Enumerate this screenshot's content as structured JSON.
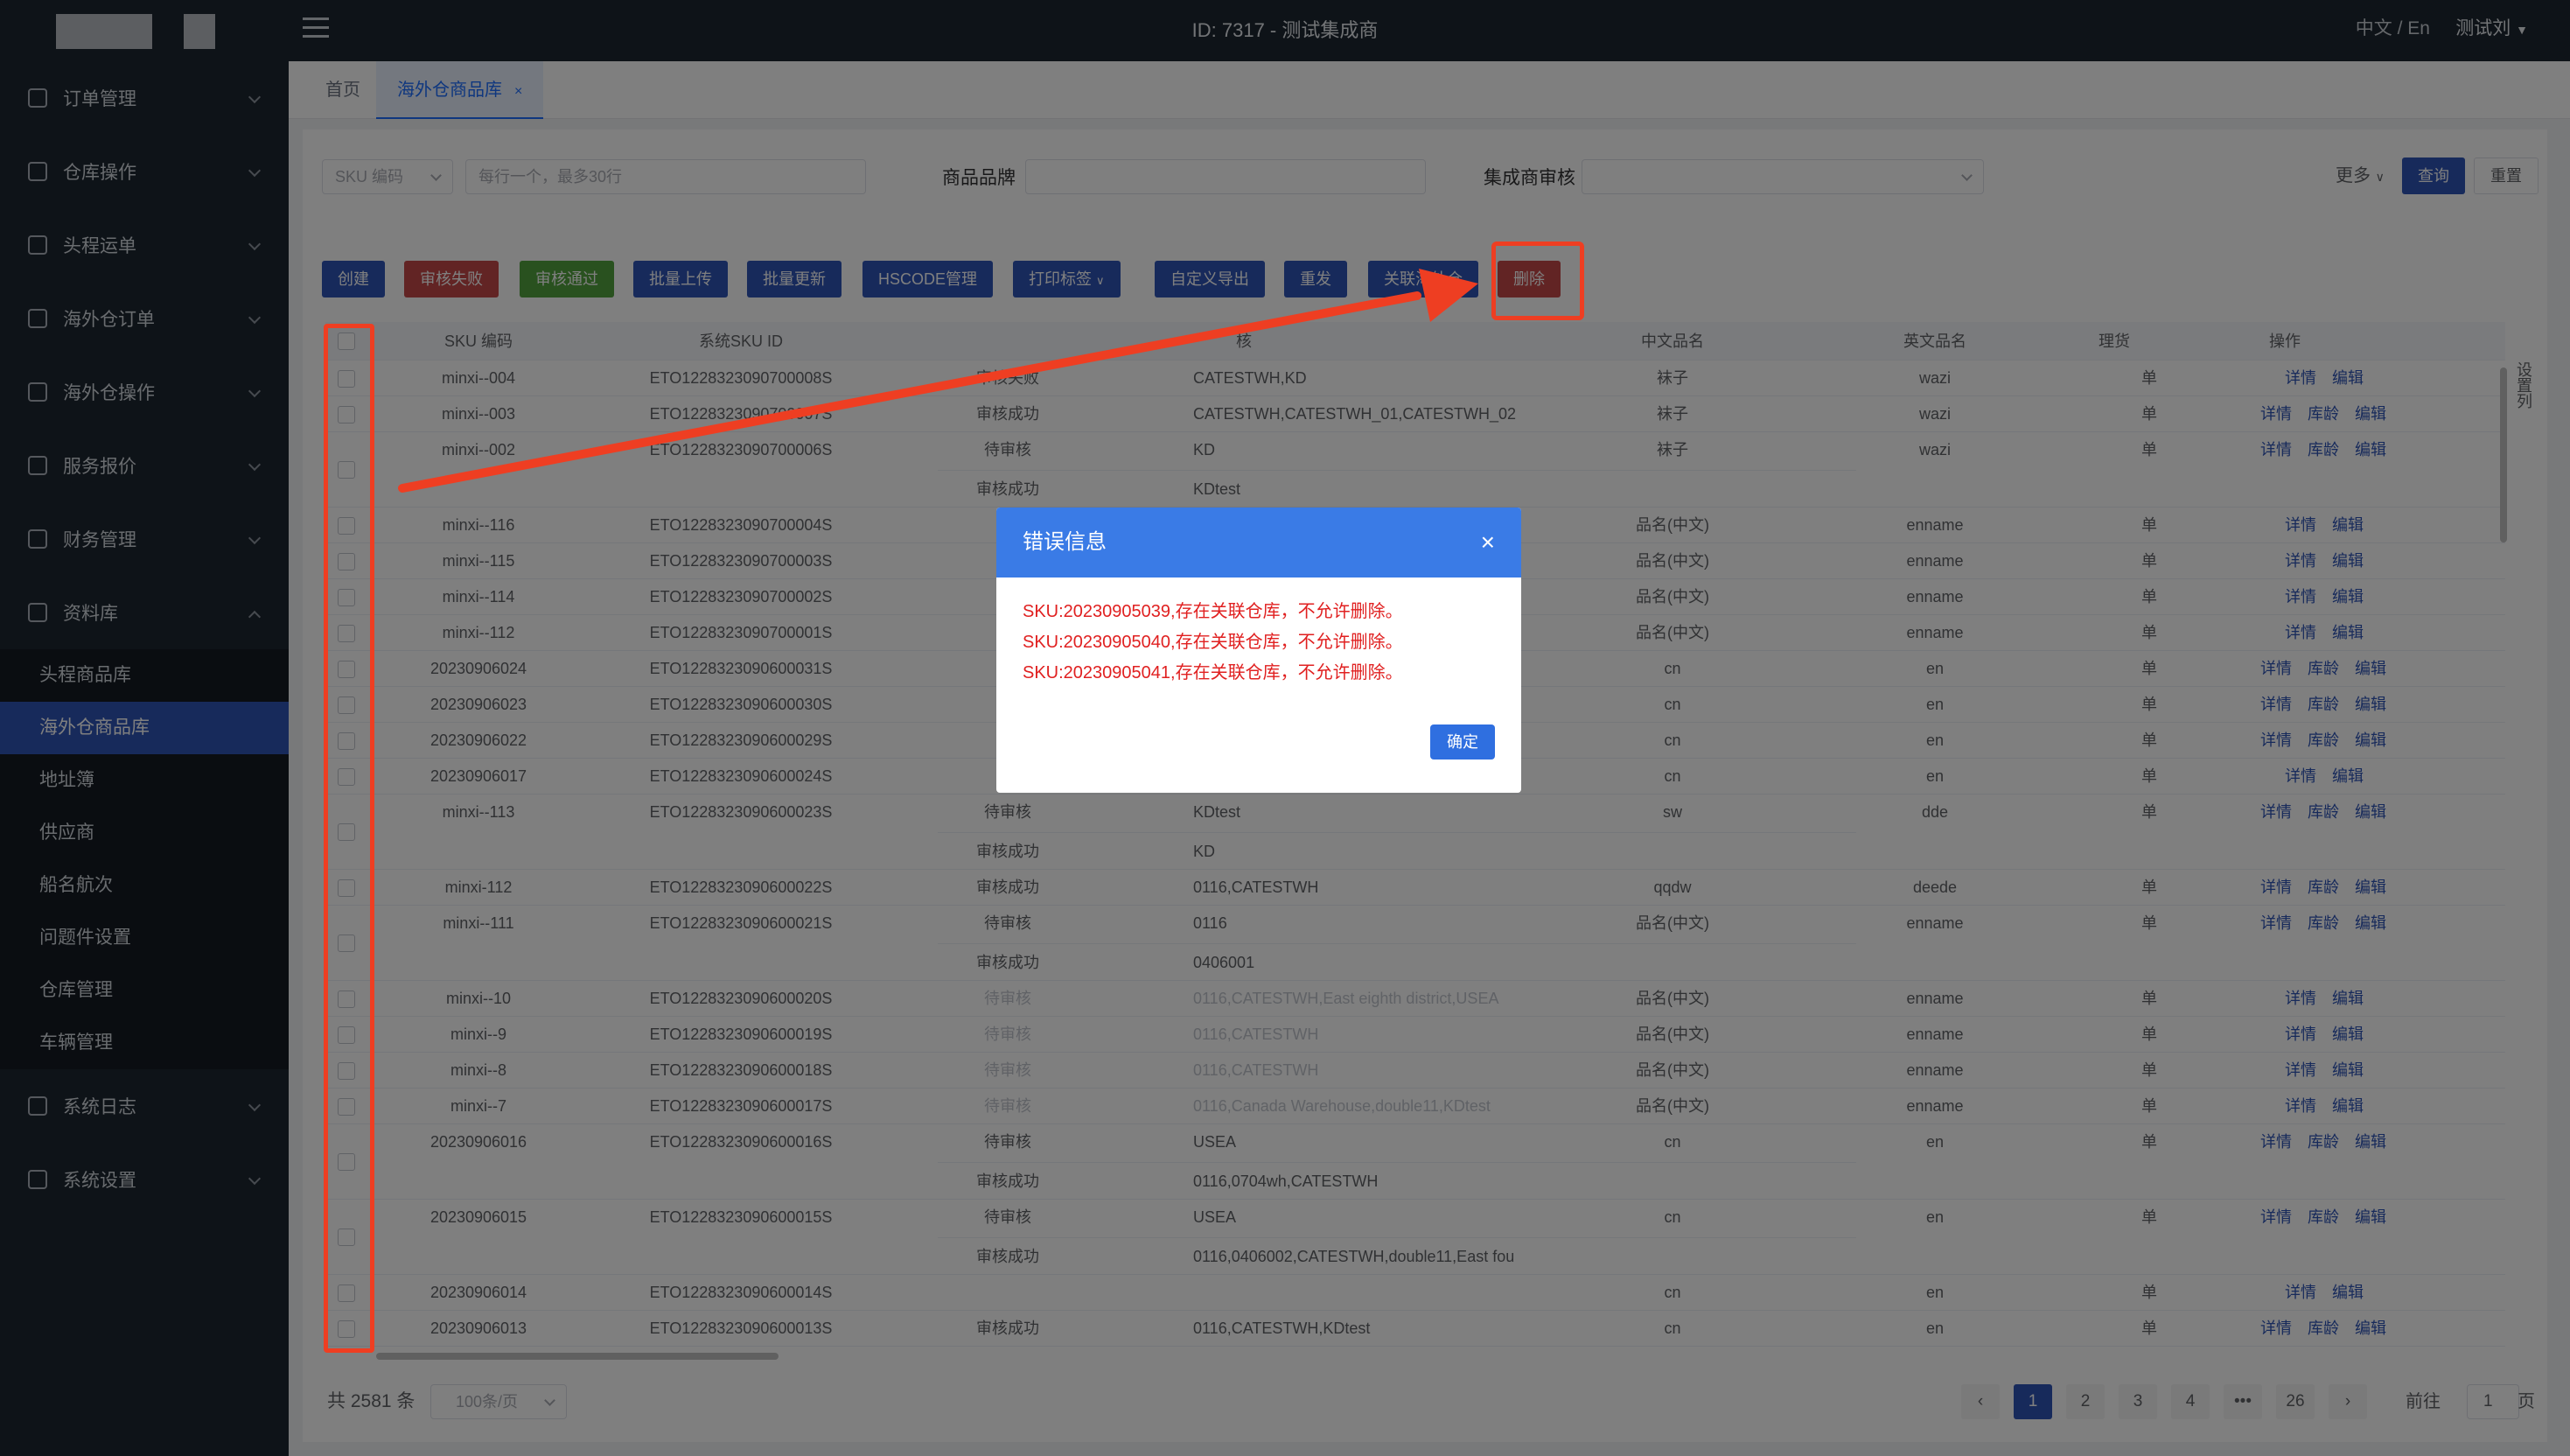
{
  "header": {
    "center_title": "ID: 7317 - 测试集成商",
    "lang": "中文 / En",
    "user": "测试刘"
  },
  "sidebar": {
    "items": [
      {
        "label": "订单管理",
        "icon": "order-icon"
      },
      {
        "label": "仓库操作",
        "icon": "warehouse-icon"
      },
      {
        "label": "头程运单",
        "icon": "waybill-icon"
      },
      {
        "label": "海外仓订单",
        "icon": "overseas-order-icon"
      },
      {
        "label": "海外仓操作",
        "icon": "overseas-ops-icon"
      },
      {
        "label": "服务报价",
        "icon": "quote-icon"
      },
      {
        "label": "财务管理",
        "icon": "finance-icon"
      },
      {
        "label": "资料库",
        "icon": "database-icon"
      },
      {
        "label": "系统日志",
        "icon": "log-icon"
      },
      {
        "label": "系统设置",
        "icon": "settings-icon"
      }
    ],
    "sub_items": [
      "头程商品库",
      "海外仓商品库",
      "地址簿",
      "供应商",
      "船名航次",
      "问题件设置",
      "仓库管理",
      "车辆管理"
    ]
  },
  "tabs": {
    "home": "首页",
    "current": "海外仓商品库",
    "close": "×"
  },
  "filters": {
    "sku_select": "SKU 编码",
    "sku_placeholder": "每行一个，最多30行",
    "brand_label": "商品品牌",
    "review_label": "集成商审核",
    "more": "更多",
    "query": "查询",
    "reset": "重置"
  },
  "toolbar": [
    "创建",
    "审核失败",
    "审核通过",
    "批量上传",
    "批量更新",
    "HSCODE管理",
    "打印标签",
    "自定义导出",
    "重发",
    "关联海外仓",
    "删除"
  ],
  "table": {
    "headers": [
      "SKU 编码",
      "系统SKU ID",
      "核",
      "中文品名",
      "英文品名",
      "理货",
      "操作"
    ],
    "rows": [
      {
        "sku": "minxi--004",
        "sys": "ETO1228323090700008S",
        "lines": [
          [
            "审核失败",
            "CATESTWH,KD"
          ]
        ],
        "cn": "袜子",
        "en": "wazi",
        "unit": "单",
        "ops": [
          "详情",
          "编辑"
        ]
      },
      {
        "sku": "minxi--003",
        "sys": "ETO1228323090700007S",
        "lines": [
          [
            "审核成功",
            "CATESTWH,CATESTWH_01,CATESTWH_02"
          ]
        ],
        "cn": "袜子",
        "en": "wazi",
        "unit": "单",
        "ops": [
          "详情",
          "库龄",
          "编辑"
        ]
      },
      {
        "sku": "minxi--002",
        "sys": "ETO1228323090700006S",
        "lines": [
          [
            "待审核",
            "KD"
          ],
          [
            "审核成功",
            "KDtest"
          ]
        ],
        "cn": "袜子",
        "en": "wazi",
        "unit": "单",
        "ops": [
          "详情",
          "库龄",
          "编辑"
        ]
      },
      {
        "sku": "minxi--116",
        "sys": "ETO1228323090700004S",
        "lines": [
          [
            "",
            ""
          ]
        ],
        "cn": "品名(中文)",
        "en": "enname",
        "unit": "单",
        "ops": [
          "详情",
          "编辑"
        ]
      },
      {
        "sku": "minxi--115",
        "sys": "ETO1228323090700003S",
        "lines": [
          [
            "",
            ""
          ]
        ],
        "cn": "品名(中文)",
        "en": "enname",
        "unit": "单",
        "ops": [
          "详情",
          "编辑"
        ]
      },
      {
        "sku": "minxi--114",
        "sys": "ETO1228323090700002S",
        "lines": [
          [
            "",
            ""
          ]
        ],
        "cn": "品名(中文)",
        "en": "enname",
        "unit": "单",
        "ops": [
          "详情",
          "编辑"
        ]
      },
      {
        "sku": "minxi--112",
        "sys": "ETO1228323090700001S",
        "lines": [
          [
            "",
            ""
          ]
        ],
        "cn": "品名(中文)",
        "en": "enname",
        "unit": "单",
        "ops": [
          "详情",
          "编辑"
        ]
      },
      {
        "sku": "20230906024",
        "sys": "ETO1228323090600031S",
        "lines": [
          [
            "",
            ""
          ]
        ],
        "cn": "cn",
        "en": "en",
        "unit": "单",
        "ops": [
          "详情",
          "库龄",
          "编辑"
        ]
      },
      {
        "sku": "20230906023",
        "sys": "ETO1228323090600030S",
        "lines": [
          [
            "",
            ""
          ]
        ],
        "cn": "cn",
        "en": "en",
        "unit": "单",
        "ops": [
          "详情",
          "库龄",
          "编辑"
        ]
      },
      {
        "sku": "20230906022",
        "sys": "ETO1228323090600029S",
        "lines": [
          [
            "",
            ""
          ]
        ],
        "cn": "cn",
        "en": "en",
        "unit": "单",
        "ops": [
          "详情",
          "库龄",
          "编辑"
        ]
      },
      {
        "sku": "20230906017",
        "sys": "ETO1228323090600024S",
        "lines": [
          [
            "",
            ""
          ]
        ],
        "cn": "cn",
        "en": "en",
        "unit": "单",
        "ops": [
          "详情",
          "编辑"
        ]
      },
      {
        "sku": "minxi--113",
        "sys": "ETO1228323090600023S",
        "lines": [
          [
            "待审核",
            "KDtest"
          ],
          [
            "审核成功",
            "KD"
          ]
        ],
        "cn": "sw",
        "en": "dde",
        "unit": "单",
        "ops": [
          "详情",
          "库龄",
          "编辑"
        ]
      },
      {
        "sku": "minxi-112",
        "sys": "ETO1228323090600022S",
        "lines": [
          [
            "审核成功",
            "0116,CATESTWH"
          ]
        ],
        "cn": "qqdw",
        "en": "deede",
        "unit": "单",
        "ops": [
          "详情",
          "库龄",
          "编辑"
        ]
      },
      {
        "sku": "minxi--111",
        "sys": "ETO1228323090600021S",
        "lines": [
          [
            "待审核",
            "0116"
          ],
          [
            "审核成功",
            "0406001"
          ]
        ],
        "cn": "品名(中文)",
        "en": "enname",
        "unit": "单",
        "ops": [
          "详情",
          "库龄",
          "编辑"
        ]
      },
      {
        "sku": "minxi--10",
        "sys": "ETO1228323090600020S",
        "lines": [
          [
            "待审核",
            "0116,CATESTWH,East eighth district,USEA"
          ]
        ],
        "faded": true,
        "cn": "品名(中文)",
        "en": "enname",
        "unit": "单",
        "ops": [
          "详情",
          "编辑"
        ]
      },
      {
        "sku": "minxi--9",
        "sys": "ETO1228323090600019S",
        "lines": [
          [
            "待审核",
            "0116,CATESTWH"
          ]
        ],
        "faded": true,
        "cn": "品名(中文)",
        "en": "enname",
        "unit": "单",
        "ops": [
          "详情",
          "编辑"
        ]
      },
      {
        "sku": "minxi--8",
        "sys": "ETO1228323090600018S",
        "lines": [
          [
            "待审核",
            "0116,CATESTWH"
          ]
        ],
        "faded": true,
        "cn": "品名(中文)",
        "en": "enname",
        "unit": "单",
        "ops": [
          "详情",
          "编辑"
        ]
      },
      {
        "sku": "minxi--7",
        "sys": "ETO1228323090600017S",
        "lines": [
          [
            "待审核",
            "0116,Canada Warehouse,double11,KDtest"
          ]
        ],
        "faded": true,
        "cn": "品名(中文)",
        "en": "enname",
        "unit": "单",
        "ops": [
          "详情",
          "编辑"
        ]
      },
      {
        "sku": "20230906016",
        "sys": "ETO1228323090600016S",
        "lines": [
          [
            "待审核",
            "USEA"
          ],
          [
            "审核成功",
            "0116,0704wh,CATESTWH"
          ]
        ],
        "cn": "cn",
        "en": "en",
        "unit": "单",
        "ops": [
          "详情",
          "库龄",
          "编辑"
        ]
      },
      {
        "sku": "20230906015",
        "sys": "ETO1228323090600015S",
        "lines": [
          [
            "待审核",
            "USEA"
          ],
          [
            "审核成功",
            "0116,0406002,CATESTWH,double11,East fou"
          ]
        ],
        "cn": "cn",
        "en": "en",
        "unit": "单",
        "ops": [
          "详情",
          "库龄",
          "编辑"
        ]
      },
      {
        "sku": "20230906014",
        "sys": "ETO1228323090600014S",
        "lines": [
          [
            "",
            ""
          ]
        ],
        "cn": "cn",
        "en": "en",
        "unit": "单",
        "ops": [
          "详情",
          "编辑"
        ]
      },
      {
        "sku": "20230906013",
        "sys": "ETO1228323090600013S",
        "lines": [
          [
            "审核成功",
            "0116,CATESTWH,KDtest"
          ]
        ],
        "cn": "cn",
        "en": "en",
        "unit": "单",
        "ops": [
          "详情",
          "库龄",
          "编辑"
        ]
      }
    ],
    "column_settings": "设置列"
  },
  "pagination": {
    "total": "共 2581 条",
    "page_size": "100条/页",
    "prev": "‹",
    "next": "›",
    "pages": [
      "1",
      "2",
      "3",
      "4",
      "•••",
      "26"
    ],
    "current": 1,
    "goto_label": "前往",
    "goto_value": "1",
    "page_unit": "页"
  },
  "dialog": {
    "title": "错误信息",
    "close": "×",
    "errors": [
      "SKU:20230905039,存在关联仓库，不允许删除。",
      "SKU:20230905040,存在关联仓库，不允许删除。",
      "SKU:20230905041,存在关联仓库，不允许删除。"
    ],
    "confirm": "确定"
  },
  "colors": {
    "primary": "#2f55b7",
    "danger": "#c44848",
    "success": "#52a23e",
    "annotation": "#ee3e22",
    "error_text": "#e02020"
  }
}
